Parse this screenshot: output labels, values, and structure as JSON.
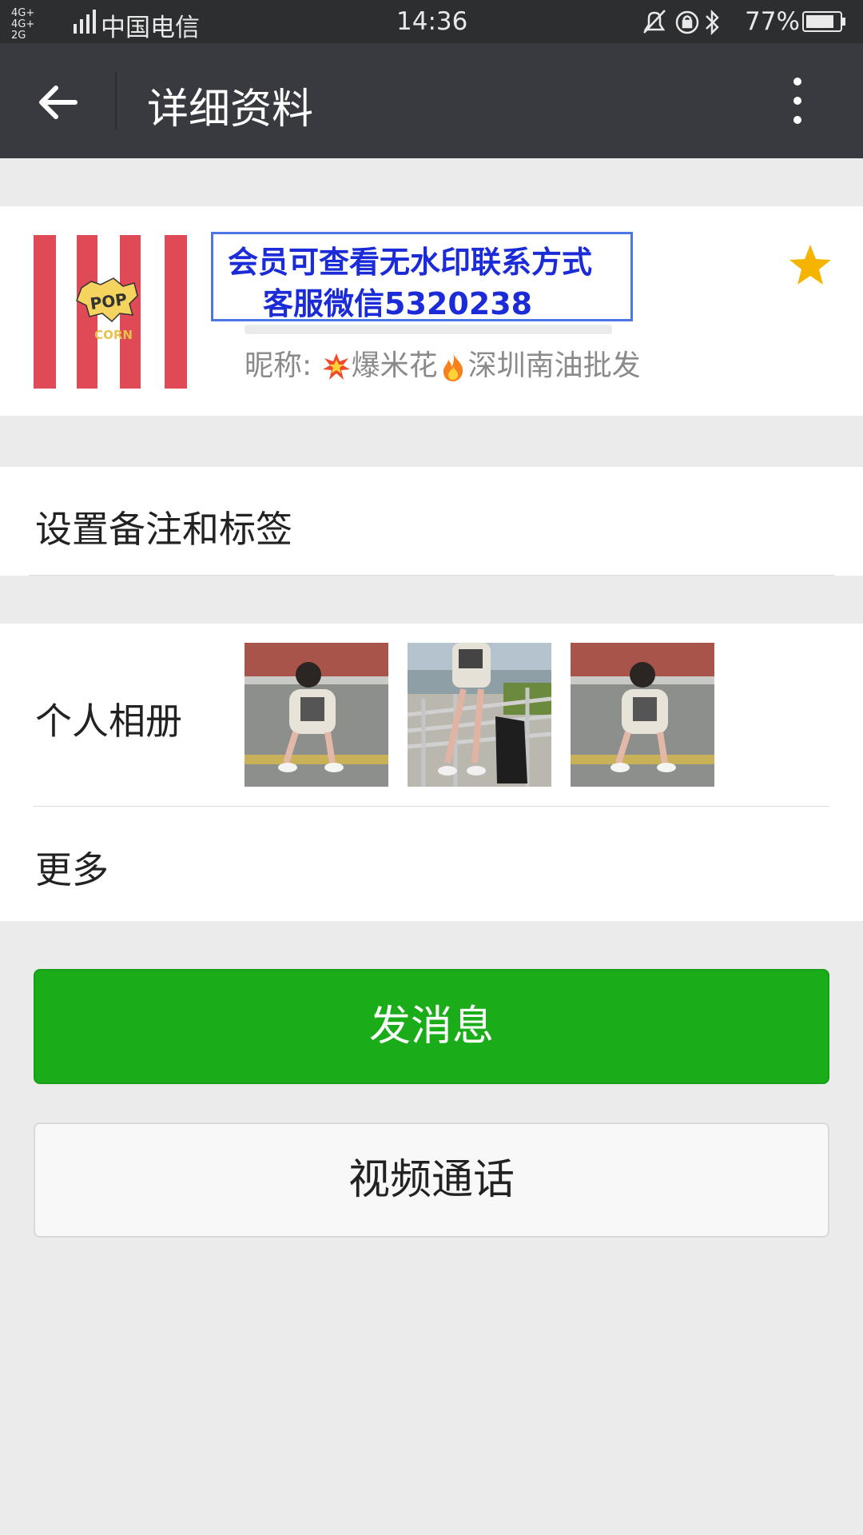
{
  "status_bar": {
    "network": "4G+ 4G+ 2G",
    "carrier": "中国电信",
    "time": "14:36",
    "battery": "77%",
    "icons": [
      "mute-icon",
      "alarm-icon",
      "bluetooth-icon",
      "battery-icon"
    ]
  },
  "nav": {
    "title": "详细资料",
    "back_icon": "arrow-left-icon",
    "more_icon": "more-vertical-icon"
  },
  "profile": {
    "watermark_line1": "会员可查看无水印联系方式",
    "watermark_line2": "客服微信5320238",
    "nickname_prefix": "昵称: ",
    "nickname_part1": "爆米花",
    "nickname_part2": "深圳南油批发",
    "avatar_text": "POP CORN",
    "starred": true
  },
  "rows": {
    "remark": "设置备注和标签",
    "album": "个人相册",
    "more": "更多"
  },
  "buttons": {
    "message": "发消息",
    "video_call": "视频通话"
  },
  "colors": {
    "nav_bg": "#393a3f",
    "status_bg": "#2d2e30",
    "primary": "#1aad19",
    "star": "#f5b400",
    "watermark_text": "#1b2bd8",
    "watermark_border": "#4a76e6"
  }
}
